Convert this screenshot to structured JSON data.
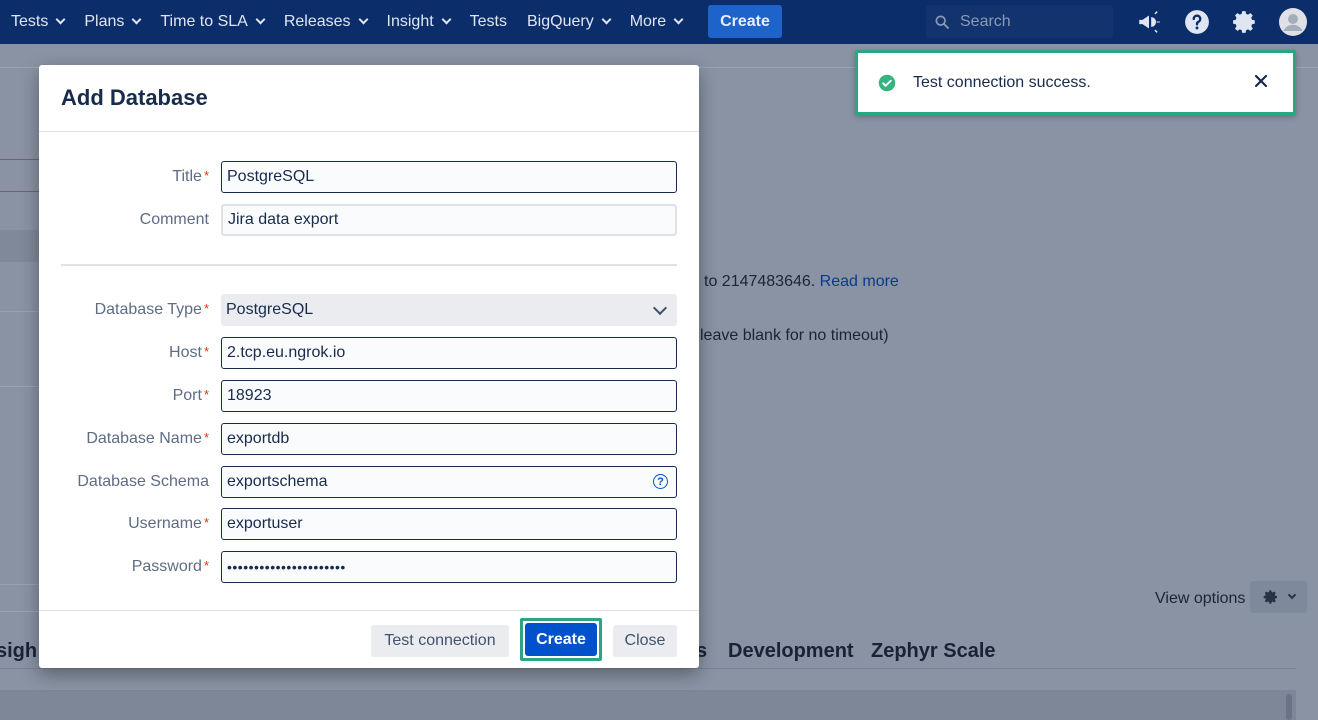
{
  "nav": {
    "items": [
      {
        "label": "Tests",
        "has_dropdown": true
      },
      {
        "label": "Plans",
        "has_dropdown": true
      },
      {
        "label": "Time to SLA",
        "has_dropdown": true
      },
      {
        "label": "Releases",
        "has_dropdown": true
      },
      {
        "label": "Insight",
        "has_dropdown": true
      },
      {
        "label": "Tests",
        "has_dropdown": false
      },
      {
        "label": "BigQuery",
        "has_dropdown": true
      },
      {
        "label": "More",
        "has_dropdown": true
      }
    ],
    "create_label": "Create",
    "search_placeholder": "Search",
    "icons": [
      "megaphone-icon",
      "help-icon",
      "gear-icon",
      "avatar"
    ]
  },
  "background": {
    "read_more_prefix": "to 2147483646.",
    "read_more_link": "Read more",
    "timeout_hint": "leave blank for no timeout)",
    "view_options_label": "View options",
    "tab_partial_left": "sigh",
    "tab_partial_s": "s",
    "tab_development": "Development",
    "tab_zephyr": "Zephyr Scale"
  },
  "toast": {
    "message": "Test connection success.",
    "status_color": "#36b37e"
  },
  "modal": {
    "title": "Add Database",
    "fields": {
      "title": {
        "label": "Title",
        "required": true,
        "value": "PostgreSQL"
      },
      "comment": {
        "label": "Comment",
        "required": false,
        "value": "Jira data export"
      },
      "database_type": {
        "label": "Database Type",
        "required": true,
        "value": "PostgreSQL"
      },
      "host": {
        "label": "Host",
        "required": true,
        "value": "2.tcp.eu.ngrok.io"
      },
      "port": {
        "label": "Port",
        "required": true,
        "value": "18923"
      },
      "database_name": {
        "label": "Database Name",
        "required": true,
        "value": "exportdb"
      },
      "database_schema": {
        "label": "Database Schema",
        "required": false,
        "value": "exportschema"
      },
      "username": {
        "label": "Username",
        "required": true,
        "value": "exportuser"
      },
      "password": {
        "label": "Password",
        "required": true,
        "value": "••••••••••••••••••••••"
      }
    },
    "required_mark": "*",
    "buttons": {
      "test_connection": "Test connection",
      "create": "Create",
      "close": "Close"
    }
  }
}
